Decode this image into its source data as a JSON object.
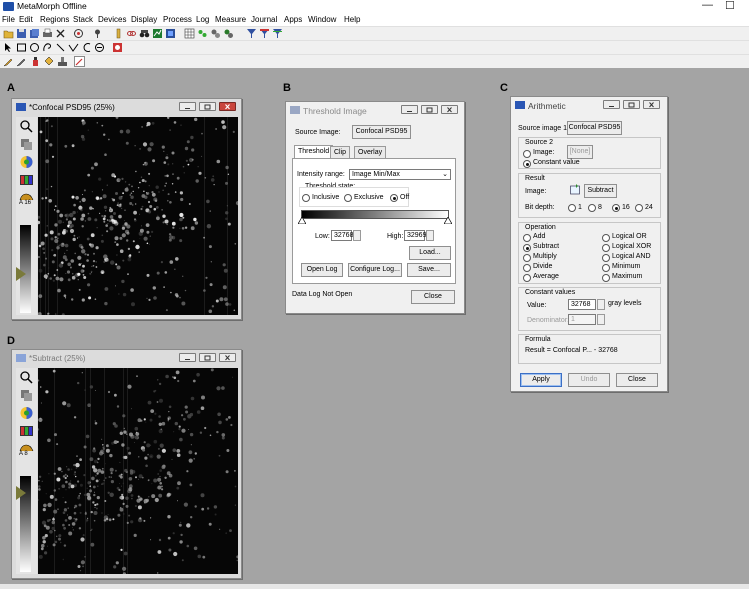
{
  "app": {
    "title": "MetaMorph Offline"
  },
  "menu": [
    "File",
    "Edit",
    "Regions",
    "Stack",
    "Devices",
    "Display",
    "Process",
    "Log",
    "Measure",
    "Journal",
    "Apps",
    "Window",
    "Help"
  ],
  "panel_labels": {
    "a": "A",
    "b": "B",
    "c": "C",
    "d": "D"
  },
  "window_a": {
    "title": "*Confocal PSD95 (25%)",
    "zoom_caption": "A 16"
  },
  "window_d": {
    "title": "*Subtract (25%)",
    "zoom_caption": "A 8"
  },
  "threshold": {
    "title": "Threshold Image",
    "source_label": "Source Image:",
    "source_button": "Confocal PSD95",
    "tabs": [
      "Threshold",
      "Clip",
      "Overlay"
    ],
    "intensity_label": "Intensity range:",
    "intensity_value": "Image Min/Max",
    "state_label": "Threshold state:",
    "state_options": [
      "Inclusive",
      "Exclusive",
      "Off"
    ],
    "state_selected": "Off",
    "low_label": "Low:",
    "low_value": "32768",
    "high_label": "High:",
    "high_value": "32969",
    "load_button": "Load...",
    "open_log_button": "Open Log",
    "configure_log_button": "Configure Log...",
    "save_button": "Save...",
    "status_text": "Data Log Not Open",
    "close_button": "Close"
  },
  "arithmetic": {
    "title": "Arithmetic",
    "source1_label": "Source image 1:",
    "source1_button": "Confocal PSD95",
    "source2_heading": "Source 2",
    "image_option": "Image:",
    "image_button": "[None]",
    "constant_option": "Constant value",
    "result_heading": "Result",
    "result_image_label": "Image:",
    "result_image_button": "Subtract",
    "bitdepth_label": "Bit depth:",
    "bitdepth_options": [
      "1",
      "8",
      "16",
      "24"
    ],
    "bitdepth_selected": "16",
    "operation_heading": "Operation",
    "operations_left": [
      "Add",
      "Subtract",
      "Multiply",
      "Divide",
      "Average"
    ],
    "operations_right": [
      "Logical OR",
      "Logical XOR",
      "Logical AND",
      "Minimum",
      "Maximum"
    ],
    "operation_selected": "Subtract",
    "constant_heading": "Constant values",
    "value_label": "Value:",
    "value": "32768",
    "gray_levels": "gray levels",
    "denominator_label": "Denominator:",
    "denominator_value": "1",
    "formula_heading": "Formula",
    "formula_text": "Result = Confocal P... - 32768",
    "apply_button": "Apply",
    "undo_button": "Undo",
    "close_button": "Close"
  }
}
